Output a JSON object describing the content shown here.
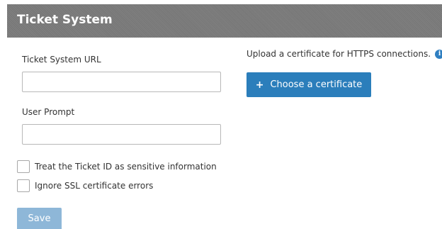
{
  "header": {
    "title": "Ticket System"
  },
  "form": {
    "url_label": "Ticket System URL",
    "url_value": "",
    "prompt_label": "User Prompt",
    "prompt_value": "",
    "checkboxes": [
      {
        "label": "Treat the Ticket ID as sensitive information",
        "checked": false
      },
      {
        "label": "Ignore SSL certificate errors",
        "checked": false
      }
    ],
    "save_label": "Save"
  },
  "certificate": {
    "upload_text": "Upload a certificate for HTTPS connections.",
    "info_icon": "i",
    "choose_icon": "+",
    "choose_label": "Choose a certificate"
  },
  "colors": {
    "header_bg": "#7a7a7a",
    "primary_button": "#2b7ebb",
    "save_button_disabled": "#8eb7d8",
    "info_icon": "#2f7fc1"
  }
}
